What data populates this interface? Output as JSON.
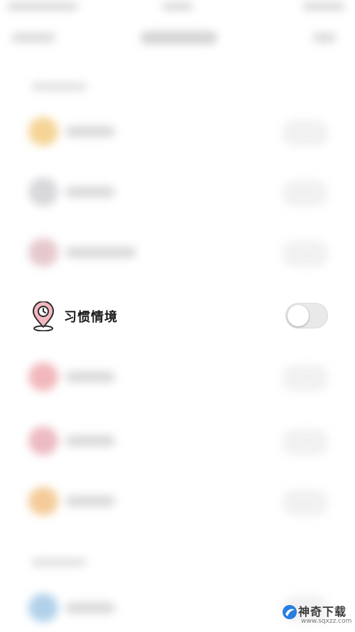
{
  "setting": {
    "label": "习惯情境",
    "toggle_on": false,
    "icon": "location-pin-clock-icon"
  },
  "watermark": {
    "title": "神奇下载",
    "url": "www.sqxzz.com",
    "icon": "logo-icon"
  },
  "colors": {
    "pin_fill": "#f5b8c0",
    "pin_stroke": "#2b2b2b",
    "toggle_track": "#e9e9e9",
    "toggle_knob": "#ffffff",
    "watermark_blue": "#2a7de1"
  }
}
